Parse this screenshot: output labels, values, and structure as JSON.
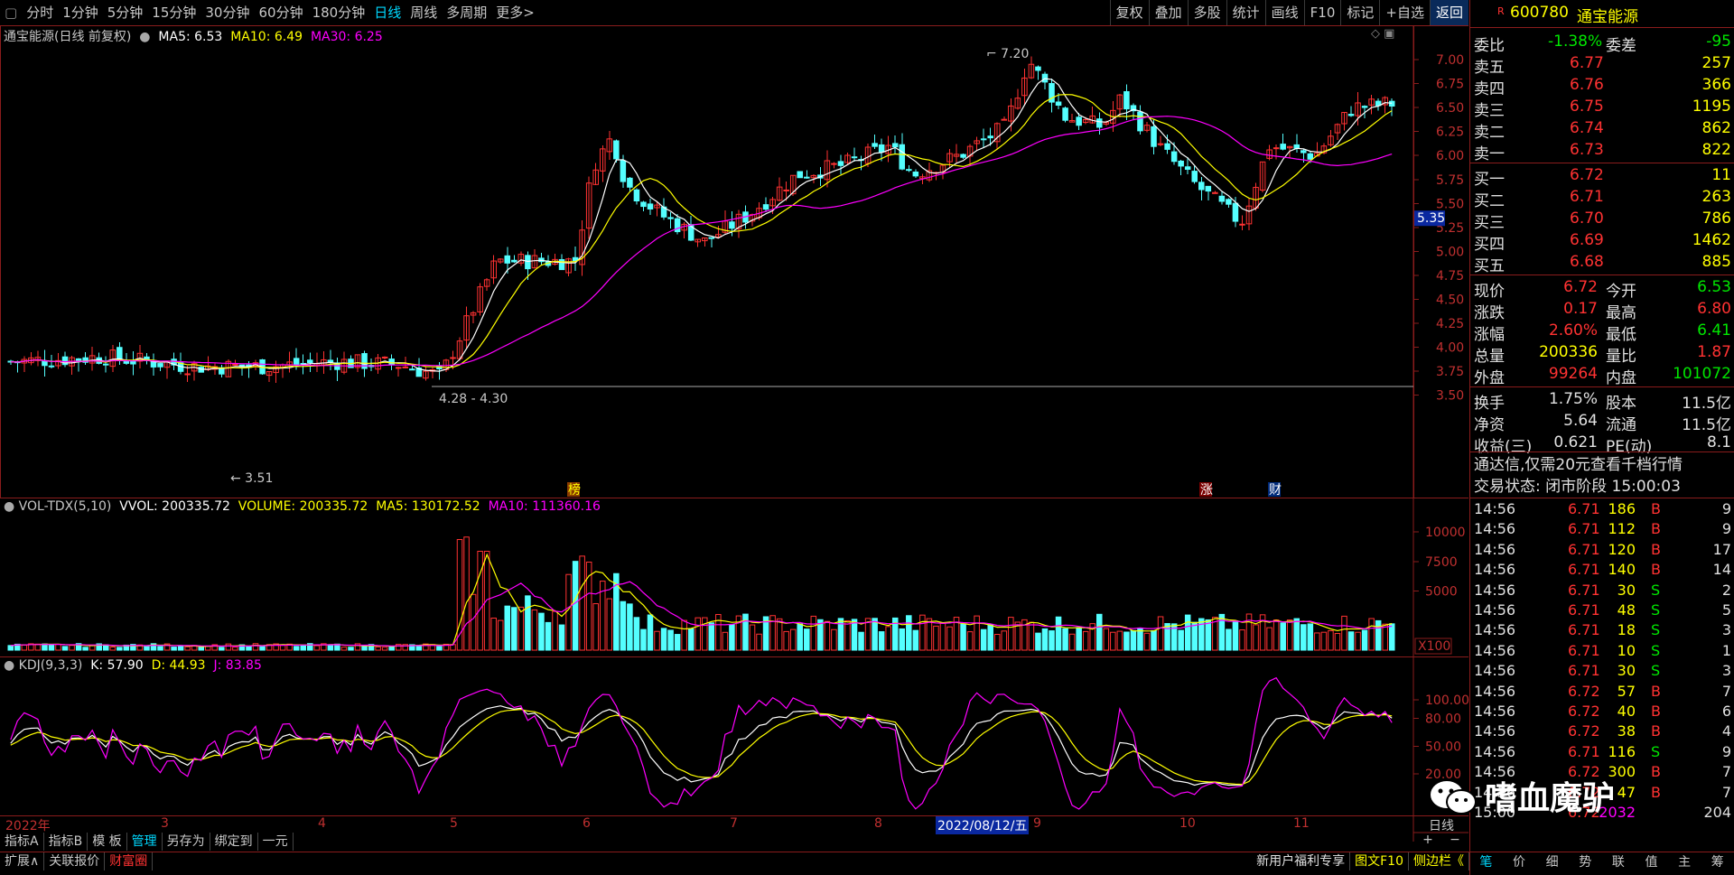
{
  "topbar": {
    "periods": [
      "分时",
      "1分钟",
      "5分钟",
      "15分钟",
      "30分钟",
      "60分钟",
      "180分钟",
      "日线",
      "周线",
      "多周期",
      "更多>"
    ],
    "active_period": "日线",
    "tools": [
      "复权",
      "叠加",
      "多股",
      "统计",
      "画线",
      "F10",
      "标记",
      "+自选",
      "返回"
    ]
  },
  "main_header": {
    "name": "通宝能源(日线 前复权)",
    "ma5": "MA5: 6.53",
    "ma10": "MA10: 6.49",
    "ma30": "MA30: 6.25"
  },
  "price_axis": [
    "7.00",
    "6.75",
    "6.50",
    "6.25",
    "6.00",
    "5.75",
    "5.50",
    "5.25",
    "5.00",
    "4.75",
    "4.50",
    "4.25",
    "4.00",
    "3.75",
    "3.50"
  ],
  "price_marker": "5.35",
  "annotations": {
    "high": "7.20",
    "low": "3.51",
    "range": "4.28 - 4.30",
    "bang": "榜",
    "zhang": "涨",
    "cai": "财"
  },
  "vol_header": {
    "name": "VOL-TDX(5,10)",
    "vvol": "VVOL: 200335.72",
    "volume": "VOLUME: 200335.72",
    "ma5": "MA5: 130172.52",
    "ma10": "MA10: 111360.16"
  },
  "vol_axis": [
    "10000",
    "7500",
    "5000"
  ],
  "vol_unit": "X100",
  "kdj_header": {
    "name": "KDJ(9,3,3)",
    "k": "K: 57.90",
    "d": "D: 44.93",
    "j": "J: 83.85"
  },
  "kdj_axis": [
    "100.00",
    "80.00",
    "50.00",
    "20.00"
  ],
  "date_axis": {
    "start": "2022年",
    "months": [
      "3",
      "4",
      "5",
      "6",
      "7",
      "8",
      "9",
      "10",
      "11"
    ],
    "cursor": "2022/08/12/五",
    "period": "日线"
  },
  "bottom_tabs": [
    "指标A",
    "指标B",
    "模 板",
    "管理",
    "另存为",
    "绑定到",
    "一元"
  ],
  "bottom_tabs2": [
    "扩展∧",
    "关联报价",
    "财富圈"
  ],
  "bottom_right": {
    "promo": "新用户福利专享",
    "f10": "图文F10",
    "side": "侧边栏《"
  },
  "quote": {
    "code": "600780",
    "name": "通宝能源",
    "weibi_label": "委比",
    "weibi": "-1.38%",
    "weicha_label": "委差",
    "weicha": "-95",
    "sell": [
      {
        "l": "卖五",
        "p": "6.77",
        "v": "257"
      },
      {
        "l": "卖四",
        "p": "6.76",
        "v": "366"
      },
      {
        "l": "卖三",
        "p": "6.75",
        "v": "1195"
      },
      {
        "l": "卖二",
        "p": "6.74",
        "v": "862"
      },
      {
        "l": "卖一",
        "p": "6.73",
        "v": "822"
      }
    ],
    "buy": [
      {
        "l": "买一",
        "p": "6.72",
        "v": "11"
      },
      {
        "l": "买二",
        "p": "6.71",
        "v": "263"
      },
      {
        "l": "买三",
        "p": "6.70",
        "v": "786"
      },
      {
        "l": "买四",
        "p": "6.69",
        "v": "1462"
      },
      {
        "l": "买五",
        "p": "6.68",
        "v": "885"
      }
    ],
    "stats": [
      {
        "l1": "现价",
        "v1": "6.72",
        "l2": "今开",
        "v2": "6.53"
      },
      {
        "l1": "涨跌",
        "v1": "0.17",
        "l2": "最高",
        "v2": "6.80"
      },
      {
        "l1": "涨幅",
        "v1": "2.60%",
        "l2": "最低",
        "v2": "6.41"
      },
      {
        "l1": "总量",
        "v1": "200336",
        "l2": "量比",
        "v2": "1.87"
      },
      {
        "l1": "外盘",
        "v1": "99264",
        "l2": "内盘",
        "v2": "101072"
      }
    ],
    "stats2": [
      {
        "l1": "换手",
        "v1": "1.75%",
        "l2": "股本",
        "v2": "11.5亿"
      },
      {
        "l1": "净资",
        "v1": "5.64",
        "l2": "流通",
        "v2": "11.5亿"
      },
      {
        "l1": "收益(三)",
        "v1": "0.621",
        "l2": "PE(动)",
        "v2": "8.1"
      }
    ],
    "notice": "通达信,仅需20元查看千档行情",
    "status": "交易状态: 闭市阶段 15:00:03"
  },
  "ticks": [
    {
      "t": "14:56",
      "p": "6.71",
      "v": "186",
      "d": "B",
      "n": "9"
    },
    {
      "t": "14:56",
      "p": "6.71",
      "v": "112",
      "d": "B",
      "n": "9"
    },
    {
      "t": "14:56",
      "p": "6.71",
      "v": "120",
      "d": "B",
      "n": "17"
    },
    {
      "t": "14:56",
      "p": "6.71",
      "v": "140",
      "d": "B",
      "n": "14"
    },
    {
      "t": "14:56",
      "p": "6.71",
      "v": "30",
      "d": "S",
      "n": "2"
    },
    {
      "t": "14:56",
      "p": "6.71",
      "v": "48",
      "d": "S",
      "n": "5"
    },
    {
      "t": "14:56",
      "p": "6.71",
      "v": "18",
      "d": "S",
      "n": "3"
    },
    {
      "t": "14:56",
      "p": "6.71",
      "v": "10",
      "d": "S",
      "n": "1"
    },
    {
      "t": "14:56",
      "p": "6.71",
      "v": "30",
      "d": "S",
      "n": "3"
    },
    {
      "t": "14:56",
      "p": "6.72",
      "v": "57",
      "d": "B",
      "n": "7"
    },
    {
      "t": "14:56",
      "p": "6.72",
      "v": "40",
      "d": "B",
      "n": "6"
    },
    {
      "t": "14:56",
      "p": "6.72",
      "v": "38",
      "d": "B",
      "n": "4"
    },
    {
      "t": "14:56",
      "p": "6.71",
      "v": "116",
      "d": "S",
      "n": "9"
    },
    {
      "t": "14:56",
      "p": "6.72",
      "v": "300",
      "d": "B",
      "n": "7"
    },
    {
      "t": "14:56",
      "p": "6.72",
      "v": "47",
      "d": "B",
      "n": "7"
    },
    {
      "t": "15:00",
      "p": "6.72",
      "v": "2032",
      "d": "",
      "n": "204"
    }
  ],
  "right_tabs": [
    "笔",
    "价",
    "细",
    "势",
    "联",
    "值",
    "主",
    "筹"
  ],
  "watermark": "嗜血魔驴",
  "colors": {
    "up": "#ff3232",
    "down": "#54ffff",
    "ma5": "#ffffff",
    "ma10": "#ffff00",
    "ma30": "#ff00ff",
    "frame": "#8a1c1c"
  }
}
